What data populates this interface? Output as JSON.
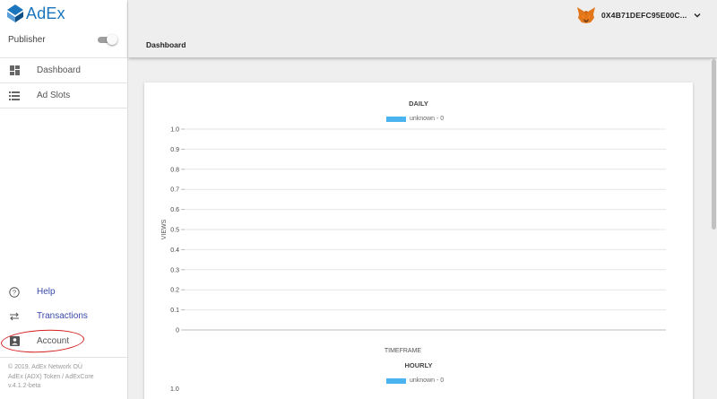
{
  "app": {
    "logo_text": "AdEx",
    "mode_label": "Publisher",
    "mode_toggle_on": true,
    "colors": {
      "brand": "#1b75bc",
      "link": "#3949ab",
      "series": "#4bb3f0",
      "annotation": "#d42020"
    }
  },
  "sidebar": {
    "nav": [
      {
        "label": "Dashboard",
        "icon": "dashboard-icon"
      },
      {
        "label": "Ad Slots",
        "icon": "list-icon"
      }
    ],
    "bottom": [
      {
        "label": "Help",
        "icon": "help-icon"
      },
      {
        "label": "Transactions",
        "icon": "swap-arrows-icon"
      },
      {
        "label": "Account",
        "icon": "account-box-icon"
      }
    ],
    "footer": {
      "line1": "© 2019. AdEx Network OÜ",
      "line2": "AdEx (ADX) Token / AdExCore",
      "line3": "v.4.1.2-beta"
    }
  },
  "header": {
    "page_title": "Dashboard",
    "account_address": "0X4B71DEFC95E00C...",
    "wallet_icon": "metamask-fox-icon",
    "dropdown_icon": "chevron-down-icon"
  },
  "chart_data": [
    {
      "type": "line",
      "title": "DAILY",
      "xlabel": "TIMEFRAME",
      "ylabel": "VIEWS",
      "ylim": [
        0,
        1
      ],
      "yticks": [
        "0",
        "0.1",
        "0.2",
        "0.3",
        "0.4",
        "0.5",
        "0.6",
        "0.7",
        "0.8",
        "0.9",
        "1.0"
      ],
      "grid": true,
      "legend": "top-center",
      "series": [
        {
          "name": "unknown - 0",
          "values": []
        }
      ]
    },
    {
      "type": "line",
      "title": "HOURLY",
      "ylim": [
        0,
        1
      ],
      "yticks": [
        "1.0"
      ],
      "legend": "top-center",
      "series": [
        {
          "name": "unknown - 0",
          "values": []
        }
      ]
    }
  ]
}
